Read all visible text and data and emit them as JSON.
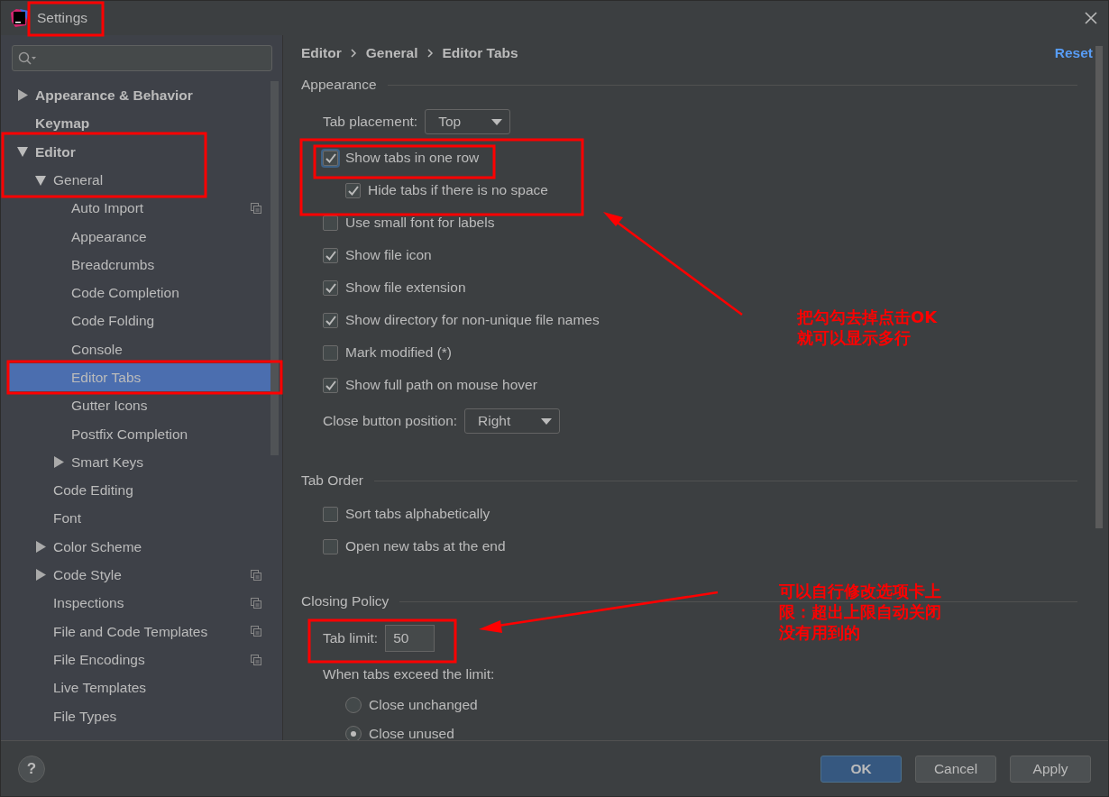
{
  "window": {
    "title": "Settings"
  },
  "sidebar": {
    "tree": [
      {
        "label": "Appearance & Behavior",
        "expanded": false,
        "selected": false
      },
      {
        "label": "Keymap",
        "selected": false
      },
      {
        "label": "Editor",
        "expanded": true,
        "selected": false,
        "children": [
          {
            "label": "General",
            "expanded": true,
            "selected": false,
            "children": [
              {
                "label": "Auto Import",
                "selected": false,
                "scoped": true
              },
              {
                "label": "Appearance",
                "selected": false
              },
              {
                "label": "Breadcrumbs",
                "selected": false
              },
              {
                "label": "Code Completion",
                "selected": false
              },
              {
                "label": "Code Folding",
                "selected": false
              },
              {
                "label": "Console",
                "selected": false
              },
              {
                "label": "Editor Tabs",
                "selected": true
              },
              {
                "label": "Gutter Icons",
                "selected": false
              },
              {
                "label": "Postfix Completion",
                "selected": false
              },
              {
                "label": "Smart Keys",
                "expanded": false,
                "selected": false
              }
            ]
          },
          {
            "label": "Code Editing",
            "selected": false
          },
          {
            "label": "Font",
            "selected": false
          },
          {
            "label": "Color Scheme",
            "expanded": false,
            "selected": false
          },
          {
            "label": "Code Style",
            "expanded": false,
            "selected": false,
            "scoped": true
          },
          {
            "label": "Inspections",
            "selected": false,
            "scoped": true
          },
          {
            "label": "File and Code Templates",
            "selected": false,
            "scoped": true
          },
          {
            "label": "File Encodings",
            "selected": false,
            "scoped": true
          },
          {
            "label": "Live Templates",
            "selected": false
          },
          {
            "label": "File Types",
            "selected": false
          }
        ]
      }
    ]
  },
  "breadcrumb": [
    "Editor",
    "General",
    "Editor Tabs"
  ],
  "reset": "Reset",
  "sections": [
    {
      "title": "Appearance",
      "rows": [
        {
          "kind": "combo",
          "label": "Tab placement:",
          "value": "Top"
        },
        {
          "kind": "checkbox",
          "label": "Show tabs in one row",
          "checked": true,
          "focused": true,
          "children": [
            {
              "kind": "checkbox",
              "label": "Hide tabs if there is no space",
              "checked": true
            }
          ]
        },
        {
          "kind": "checkbox",
          "label": "Use small font for labels",
          "checked": false
        },
        {
          "kind": "checkbox",
          "label": "Show file icon",
          "checked": true
        },
        {
          "kind": "checkbox",
          "label": "Show file extension",
          "checked": true
        },
        {
          "kind": "checkbox",
          "label": "Show directory for non-unique file names",
          "checked": true
        },
        {
          "kind": "checkbox",
          "label": "Mark modified (*)",
          "checked": false
        },
        {
          "kind": "checkbox",
          "label": "Show full path on mouse hover",
          "checked": true
        },
        {
          "kind": "combo",
          "label": "Close button position:",
          "value": "Right"
        }
      ]
    },
    {
      "title": "Tab Order",
      "rows": [
        {
          "kind": "checkbox",
          "label": "Sort tabs alphabetically",
          "checked": false
        },
        {
          "kind": "checkbox",
          "label": "Open new tabs at the end",
          "checked": false
        }
      ]
    },
    {
      "title": "Closing Policy",
      "rows": [
        {
          "kind": "input",
          "label": "Tab limit:",
          "value": "50"
        },
        {
          "kind": "label",
          "label": "When tabs exceed the limit:",
          "children": [
            {
              "kind": "radio",
              "label": "Close unchanged",
              "selected": false
            },
            {
              "kind": "radio",
              "label": "Close unused",
              "selected": true
            }
          ]
        }
      ]
    }
  ],
  "annotations": [
    {
      "lines": [
        "把勾勾去掉点击OK",
        "就可以显示多行"
      ]
    },
    {
      "lines": [
        "可以自行修改选项卡上",
        "限：超出上限自动关闭",
        "没有用到的"
      ]
    }
  ],
  "help": "?",
  "buttons": [
    {
      "label": "OK",
      "default": true
    },
    {
      "label": "Cancel",
      "default": false
    },
    {
      "label": "Apply",
      "default": false
    }
  ]
}
